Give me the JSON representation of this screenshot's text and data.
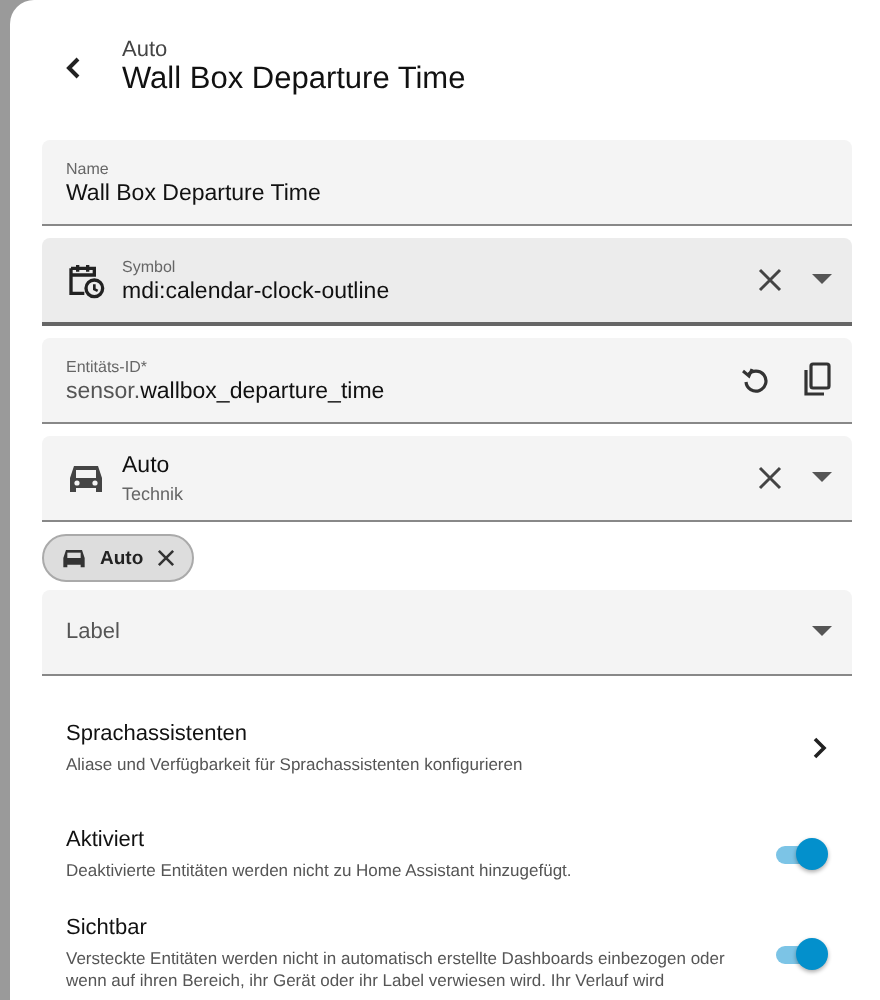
{
  "header": {
    "subtitle": "Auto",
    "title": "Wall Box Departure Time"
  },
  "fields": [
    {
      "kind": "text",
      "label": "Name",
      "value": "Wall Box Departure Time"
    },
    {
      "kind": "icon",
      "label": "Symbol",
      "value": "mdi:calendar-clock-outline"
    },
    {
      "kind": "entity",
      "label": "Entitäts-ID*",
      "prefix": "sensor.",
      "value": "wallbox_departure_time"
    },
    {
      "kind": "area",
      "value": "Auto",
      "secondary": "Technik"
    }
  ],
  "chips": [
    {
      "label": "Auto"
    }
  ],
  "label_select": {
    "placeholder": "Label"
  },
  "voice": {
    "title": "Sprachassistenten",
    "description": "Aliase und Verfügbarkeit für Sprachassistenten konfigurieren"
  },
  "toggles": [
    {
      "title": "Aktiviert",
      "description": "Deaktivierte Entitäten werden nicht zu Home Assistant hinzugefügt.",
      "on": true
    },
    {
      "title": "Sichtbar",
      "description": "Versteckte Entitäten werden nicht in automatisch erstellte Dashboards einbezogen oder wenn auf ihren Bereich, ihr Gerät oder ihr Label verwiesen wird. Ihr Verlauf wird",
      "on": true
    }
  ]
}
